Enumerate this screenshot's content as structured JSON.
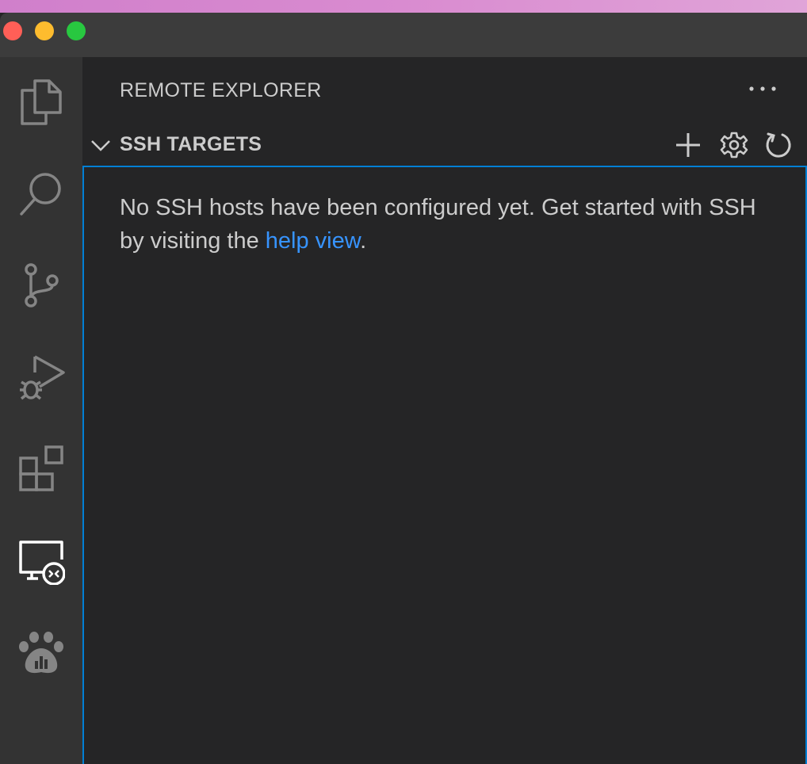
{
  "window": {
    "controls": [
      "close",
      "minimize",
      "maximize"
    ],
    "colors": {
      "close": "#ff5f57",
      "minimize": "#febc2e",
      "maximize": "#28c840"
    }
  },
  "activity_bar": {
    "items": [
      {
        "icon": "files-icon",
        "active": false
      },
      {
        "icon": "search-icon",
        "active": false
      },
      {
        "icon": "source-control-icon",
        "active": false
      },
      {
        "icon": "run-debug-icon",
        "active": false
      },
      {
        "icon": "extensions-icon",
        "active": false
      },
      {
        "icon": "remote-explorer-icon",
        "active": true
      },
      {
        "icon": "paw-chart-icon",
        "active": false
      }
    ]
  },
  "sidebar": {
    "title": "REMOTE EXPLORER",
    "more_actions_icon": "ellipsis-icon",
    "section": {
      "title": "SSH TARGETS",
      "expanded": true,
      "actions": [
        "add-icon",
        "gear-icon",
        "refresh-icon"
      ],
      "message_before": "No SSH hosts have been configured yet. Get started with SSH by visiting the ",
      "link_text": "help view",
      "message_after": "."
    }
  },
  "colors": {
    "accent_border": "#007fd4",
    "link": "#3794ff",
    "text": "#cccccc",
    "sidebar_bg": "#252526",
    "activity_bg": "#333333"
  }
}
